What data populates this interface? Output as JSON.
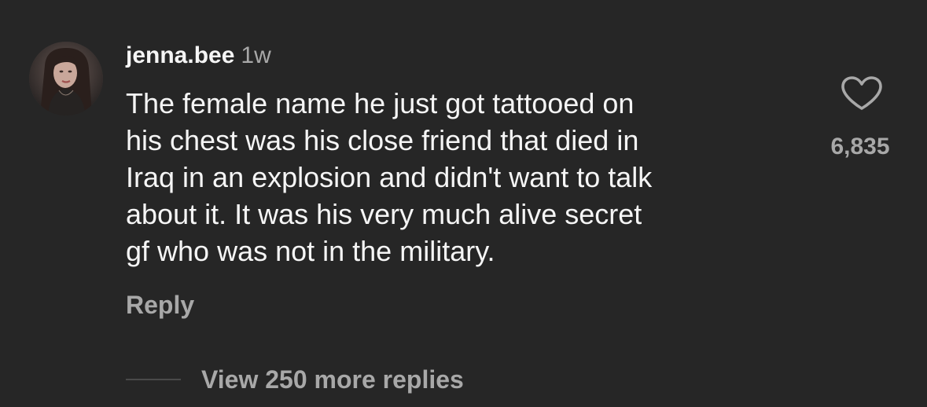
{
  "comment": {
    "username": "jenna.bee",
    "timestamp": "1w",
    "text_lines": [
      "The female name he just got tattooed on",
      "his chest was his close friend that died in",
      "Iraq in an explosion and didn't want to talk",
      "about it. It was his very much alive secret",
      "gf who was not in the military."
    ],
    "reply_label": "Reply",
    "like_count": "6,835",
    "view_replies_label": "View 250 more replies"
  },
  "icons": {
    "like": "heart-outline-icon",
    "avatar": "profile-photo"
  },
  "colors": {
    "background": "#262626",
    "primary_text": "#f5f5f5",
    "secondary_text": "#a8a8a8"
  }
}
